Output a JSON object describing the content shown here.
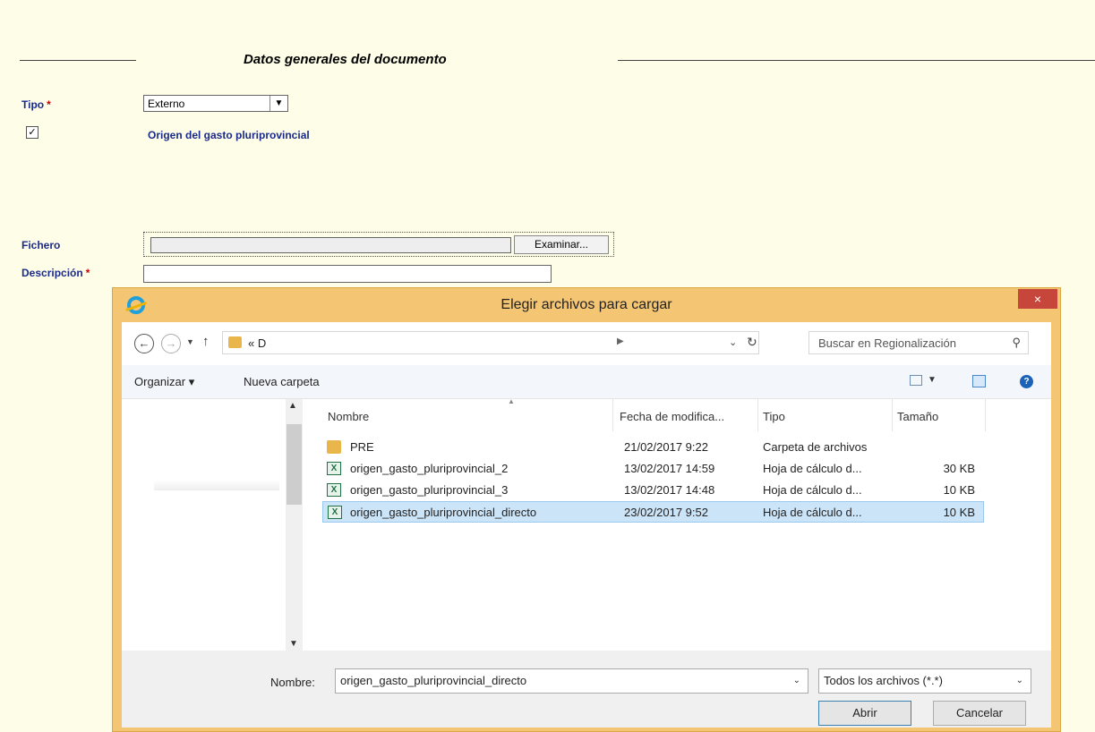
{
  "form": {
    "section_title": "Datos generales del documento",
    "tipo_label": "Tipo",
    "required_mark": "*",
    "tipo_value": "Externo",
    "checkbox_checked": true,
    "checkbox_label": "Origen del gasto pluriprovincial",
    "fichero_label": "Fichero",
    "browse_button": "Examinar...",
    "descripcion_label": "Descripción"
  },
  "dialog": {
    "title": "Elegir archivos para cargar",
    "close_glyph": "×",
    "address_path": "« D",
    "search_placeholder": "Buscar en Regionalización",
    "toolbar": {
      "organize": "Organizar ▾",
      "new_folder": "Nueva carpeta"
    },
    "columns": {
      "name": "Nombre",
      "date": "Fecha de modifica...",
      "type": "Tipo",
      "size": "Tamaño"
    },
    "files": [
      {
        "name": "PRE",
        "date": "21/02/2017 9:22",
        "type": "Carpeta de archivos",
        "size": "",
        "icon": "folder-icon",
        "selected": false
      },
      {
        "name": "origen_gasto_pluriprovincial_2",
        "date": "13/02/2017 14:59",
        "type": "Hoja de cálculo d...",
        "size": "30 KB",
        "icon": "spreadsheet-icon",
        "selected": false
      },
      {
        "name": "origen_gasto_pluriprovincial_3",
        "date": "13/02/2017 14:48",
        "type": "Hoja de cálculo d...",
        "size": "10 KB",
        "icon": "spreadsheet-icon",
        "selected": false
      },
      {
        "name": "origen_gasto_pluriprovincial_directo",
        "date": "23/02/2017 9:52",
        "type": "Hoja de cálculo d...",
        "size": "10 KB",
        "icon": "spreadsheet-icon",
        "selected": true
      }
    ],
    "filename_label": "Nombre:",
    "filename_value": "origen_gasto_pluriprovincial_directo",
    "filter_value": "Todos los archivos (*.*)",
    "open_button": "Abrir",
    "cancel_button": "Cancelar"
  }
}
